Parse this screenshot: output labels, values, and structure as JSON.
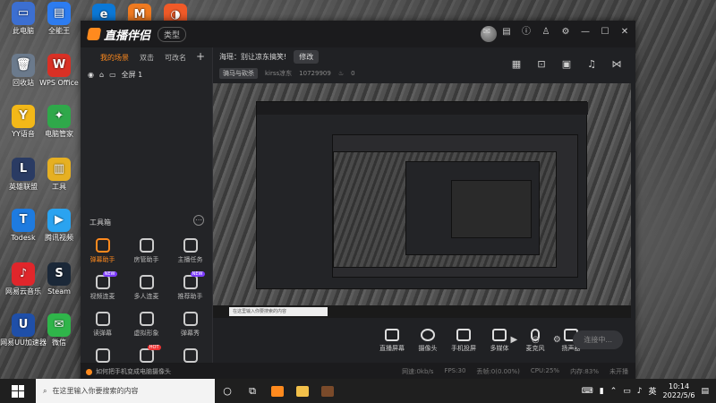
{
  "desktop": {
    "icons": [
      {
        "label": "此电脑",
        "glyph": "▭",
        "color": "#3c6fd1"
      },
      {
        "label": "回收站",
        "glyph": "🗑",
        "color": "#6b7a8c"
      },
      {
        "label": "YY语音",
        "glyph": "Y",
        "color": "#f3b818"
      },
      {
        "label": "英雄联盟",
        "glyph": "L",
        "color": "#2a3b63"
      },
      {
        "label": "Todesk",
        "glyph": "T",
        "color": "#1e7be0"
      },
      {
        "label": "网易云音乐",
        "glyph": "♪",
        "color": "#e0262b"
      },
      {
        "label": "网易UU加速器",
        "glyph": "U",
        "color": "#1f4fa8"
      },
      {
        "label": "全能王",
        "glyph": "▤",
        "color": "#2d7cf0"
      },
      {
        "label": "WPS Office",
        "glyph": "W",
        "color": "#d93025"
      },
      {
        "label": "电脑管家",
        "glyph": "✦",
        "color": "#2fa84a"
      },
      {
        "label": "工具",
        "glyph": "▥",
        "color": "#e6b022"
      },
      {
        "label": "腾讯视频",
        "glyph": "▶",
        "color": "#2aa3f0"
      },
      {
        "label": "Steam",
        "glyph": "S",
        "color": "#1b2838"
      },
      {
        "label": "微信",
        "glyph": "✉",
        "color": "#2fb54a"
      },
      {
        "label": "",
        "glyph": "e",
        "color": "#0b78d7"
      },
      {
        "label": "",
        "glyph": "M",
        "color": "#f07a20"
      },
      {
        "label": "",
        "glyph": "◑",
        "color": "#f05a28"
      }
    ]
  },
  "window": {
    "app_name": "直播伴侣",
    "type_label": "类型",
    "title_icons": [
      "mail-icon",
      "feedback-icon",
      "info-icon",
      "shirt-icon",
      "settings-icon",
      "minimize-icon",
      "maximize-icon",
      "close-icon"
    ],
    "left": {
      "tabs": [
        "我的场景",
        "双击",
        "可改名"
      ],
      "add": "+",
      "scene_name": "全屏 1",
      "toolbox_title": "工具箱",
      "tools": [
        {
          "label": "弹幕助手",
          "hot": true,
          "badge": ""
        },
        {
          "label": "房管助手",
          "hot": false,
          "badge": ""
        },
        {
          "label": "主播任务",
          "hot": false,
          "badge": ""
        },
        {
          "label": "视频连麦",
          "hot": false,
          "badge": "NEW"
        },
        {
          "label": "多人连麦",
          "hot": false,
          "badge": ""
        },
        {
          "label": "推荐助手",
          "hot": false,
          "badge": "NEW"
        },
        {
          "label": "读弹幕",
          "hot": false,
          "badge": ""
        },
        {
          "label": "虚拟形象",
          "hot": false,
          "badge": ""
        },
        {
          "label": "弹幕秀",
          "hot": false,
          "badge": ""
        },
        {
          "label": "",
          "hot": false,
          "badge": ""
        },
        {
          "label": "",
          "hot": false,
          "badge": "HOT"
        },
        {
          "label": "",
          "hot": false,
          "badge": ""
        }
      ]
    },
    "header": {
      "title": "海瑶：别让凉东搞笑!",
      "edit_label": "修改",
      "tag": "骑马与砍杀",
      "streamer": "kirss凉东",
      "room_id": "10729909",
      "heat": "0"
    },
    "bottom_tools": [
      "直播屏幕",
      "摄像头",
      "手机投屏",
      "多媒体",
      "麦克风",
      "扬声器"
    ],
    "go_live": "连接中...",
    "tip": "如何把手机变成电脑摄像头",
    "stats": [
      "网速:0kb/s",
      "FPS:30",
      "丢帧:0(0.00%)",
      "CPU:25%",
      "内存:83%",
      "未开播"
    ]
  },
  "taskbar": {
    "search_placeholder": "在这里输入你要搜索的内容",
    "input_method": "英",
    "time": "10:14",
    "date": "2022/5/6"
  }
}
